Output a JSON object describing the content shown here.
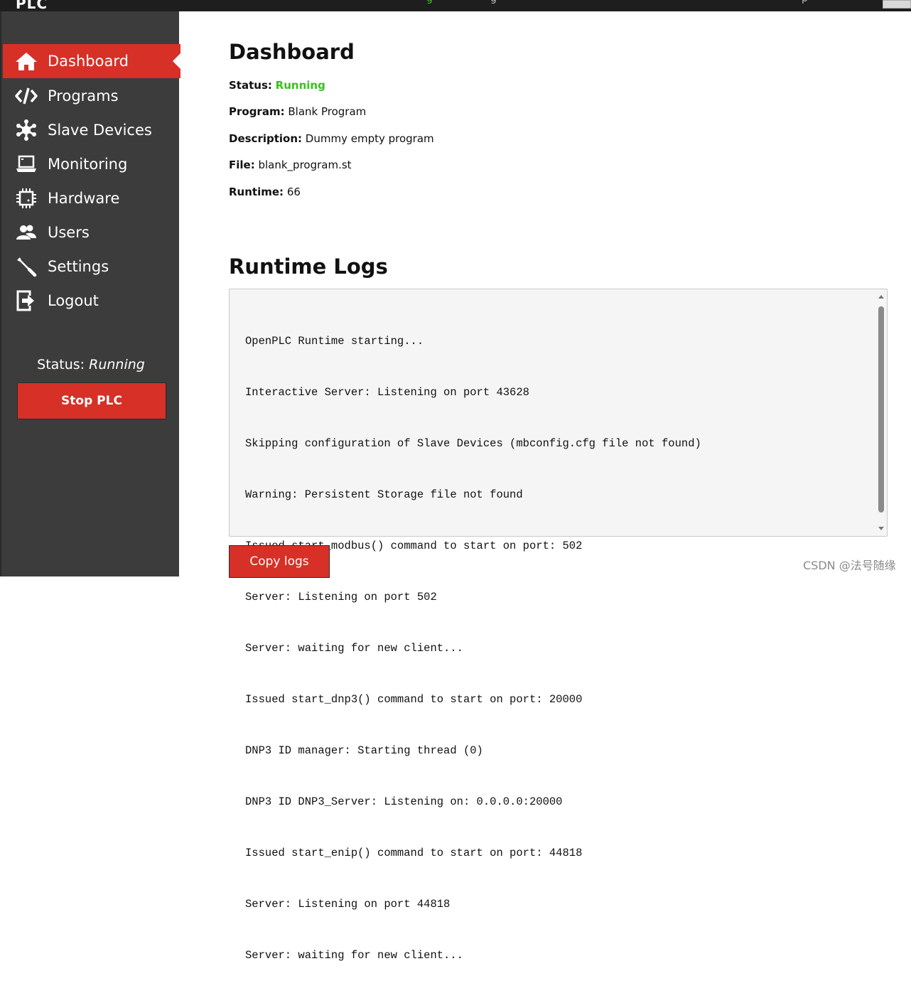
{
  "topbar": {
    "logo": "PLC",
    "fragment_green": "g",
    "fragment_gray": "g",
    "fragment_right": "p"
  },
  "sidebar": {
    "items": [
      {
        "label": "Dashboard",
        "icon": "home-icon",
        "active": true
      },
      {
        "label": "Programs",
        "icon": "code-icon"
      },
      {
        "label": "Slave Devices",
        "icon": "network-icon"
      },
      {
        "label": "Monitoring",
        "icon": "laptop-icon"
      },
      {
        "label": "Hardware",
        "icon": "chip-icon"
      },
      {
        "label": "Users",
        "icon": "users-icon"
      },
      {
        "label": "Settings",
        "icon": "wrench-icon"
      },
      {
        "label": "Logout",
        "icon": "logout-icon"
      }
    ],
    "status_label": "Status:",
    "status_value": "Running",
    "stop_button": "Stop PLC"
  },
  "main": {
    "title": "Dashboard",
    "status_label": "Status:",
    "status_value": "Running",
    "program_label": "Program:",
    "program_value": "Blank Program",
    "description_label": "Description:",
    "description_value": "Dummy empty program",
    "file_label": "File:",
    "file_value": "blank_program.st",
    "runtime_label": "Runtime:",
    "runtime_value": "66",
    "logs_title": "Runtime Logs",
    "logs": [
      "OpenPLC Runtime starting...",
      "Interactive Server: Listening on port 43628",
      "Skipping configuration of Slave Devices (mbconfig.cfg file not found)",
      "Warning: Persistent Storage file not found",
      "Issued start_modbus() command to start on port: 502",
      "Server: Listening on port 502",
      "Server: waiting for new client...",
      "Issued start_dnp3() command to start on port: 20000",
      "DNP3 ID manager: Starting thread (0)",
      "DNP3 ID DNP3_Server: Listening on: 0.0.0.0:20000",
      "Issued start_enip() command to start on port: 44818",
      "Server: Listening on port 44818",
      "Server: waiting for new client..."
    ],
    "copy_button": "Copy logs"
  },
  "watermark": "CSDN @法号随缘",
  "colors": {
    "accent": "#d63027",
    "running": "#39c01e",
    "sidebar_bg": "#3c3c3c"
  }
}
